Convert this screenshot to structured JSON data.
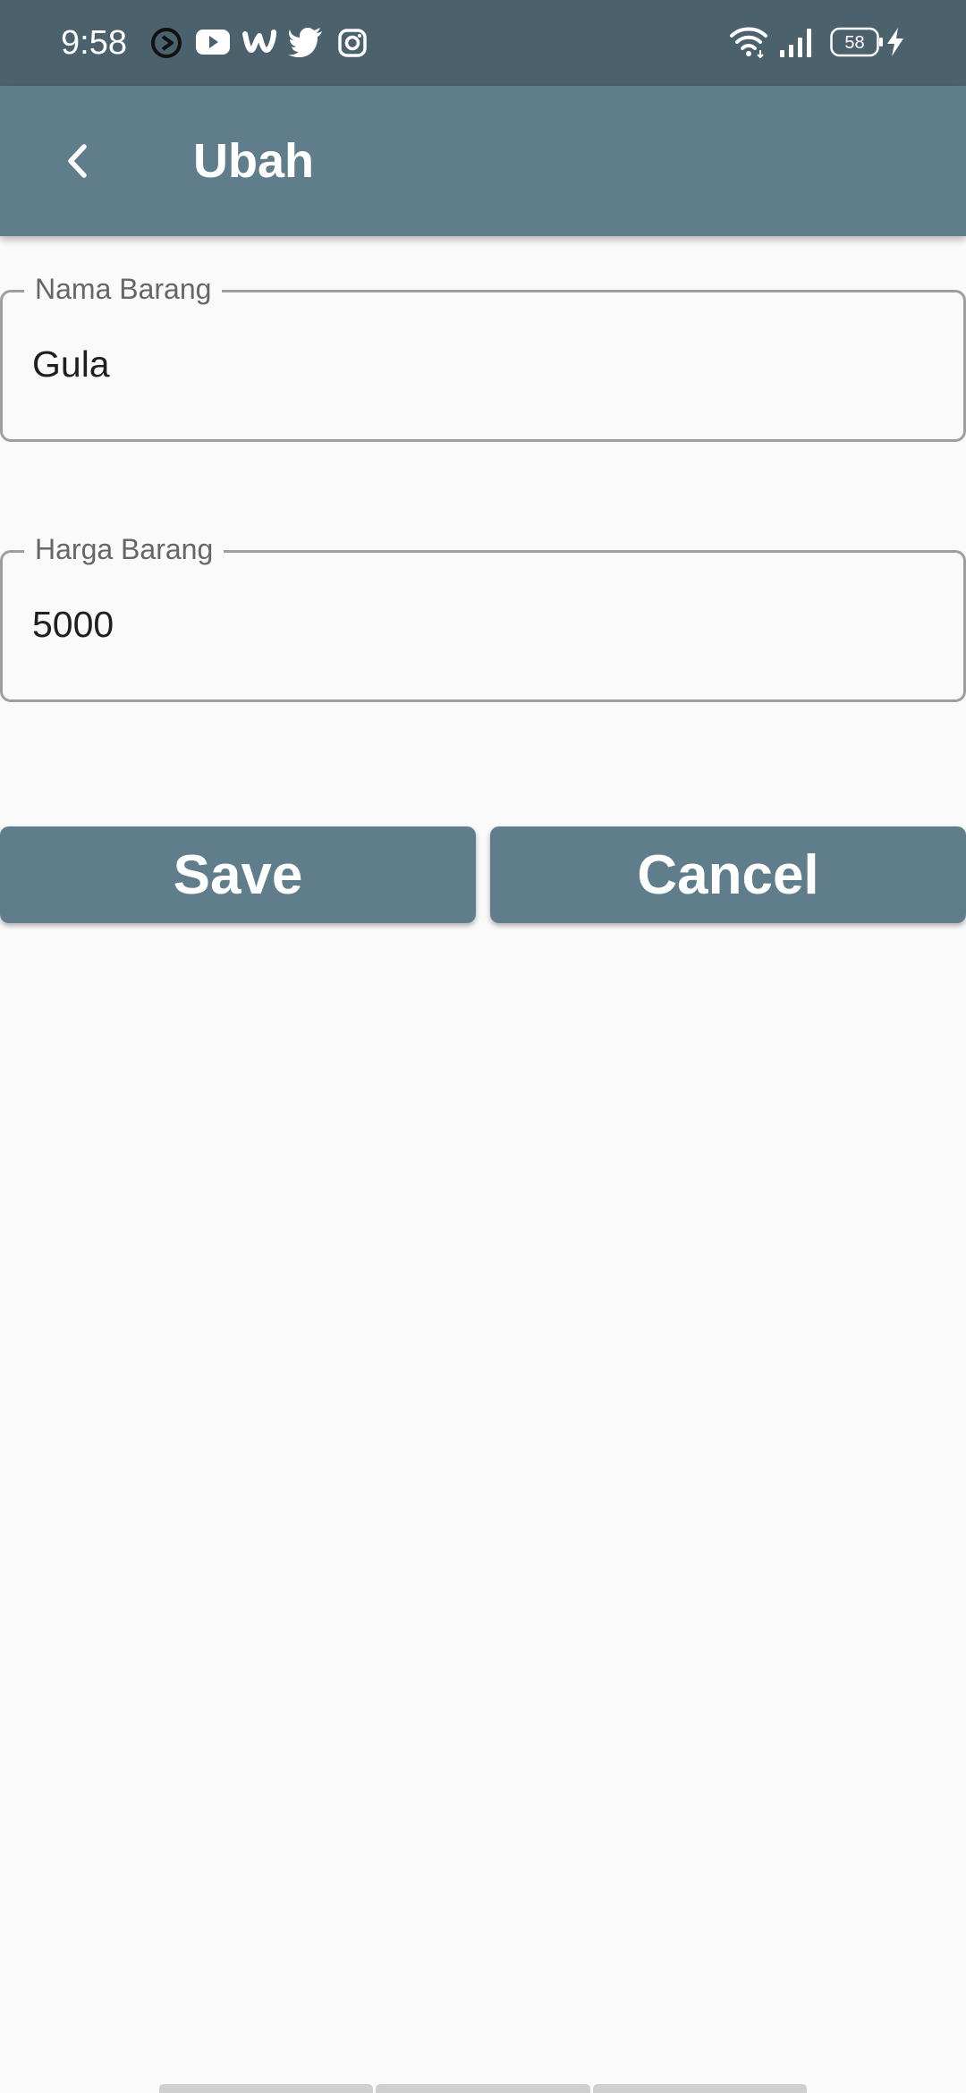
{
  "status_bar": {
    "time": "9:58",
    "notification_icons": [
      "circle-play-icon",
      "youtube-icon",
      "wattpad-icon",
      "twitter-icon",
      "instagram-icon"
    ],
    "wifi_icon": "wifi-icon",
    "signal_icon": "signal-icon",
    "battery_level": "58",
    "charging_icon": "bolt-icon"
  },
  "app_bar": {
    "back_icon": "chevron-left-icon",
    "title": "Ubah"
  },
  "form": {
    "nama_barang": {
      "label": "Nama Barang",
      "value": "Gula"
    },
    "harga_barang": {
      "label": "Harga Barang",
      "value": "5000"
    }
  },
  "actions": {
    "save_label": "Save",
    "cancel_label": "Cancel"
  },
  "colors": {
    "status_bar": "#4b616c",
    "primary": "#607d8b",
    "background": "#fafafa",
    "field_border": "#9e9e9e"
  }
}
